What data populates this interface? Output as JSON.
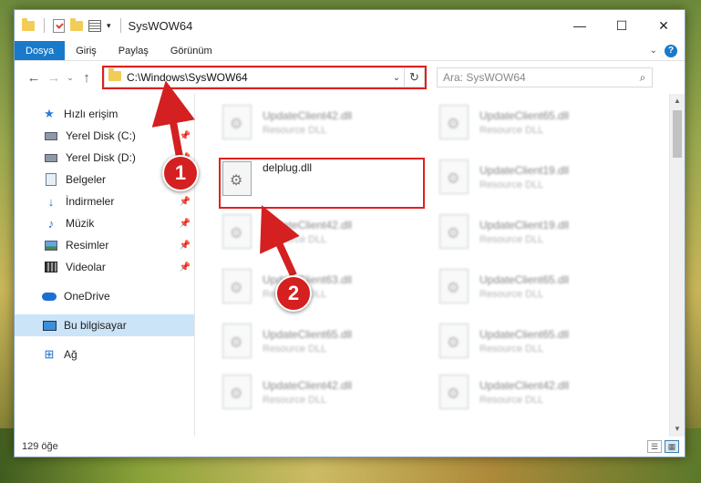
{
  "window": {
    "title": "SysWOW64",
    "controls": {
      "minimize": "—",
      "maximize": "☐",
      "close": "✕"
    }
  },
  "ribbon": {
    "tabs": [
      {
        "label": "Dosya",
        "active": true
      },
      {
        "label": "Giriş",
        "active": false
      },
      {
        "label": "Paylaş",
        "active": false
      },
      {
        "label": "Görünüm",
        "active": false
      }
    ],
    "help_label": "?"
  },
  "navigation": {
    "back": "←",
    "forward": "→",
    "recent": "⌄",
    "up": "↑",
    "address": "C:\\Windows\\SysWOW64",
    "search_placeholder": "Ara: SysWOW64"
  },
  "sidebar": {
    "items": [
      {
        "label": "Hızlı erişim",
        "icon": "star-icon",
        "pinned": false,
        "selected": false
      },
      {
        "label": "Yerel Disk (C:)",
        "icon": "drive-icon",
        "pinned": true,
        "selected": false
      },
      {
        "label": "Yerel Disk (D:)",
        "icon": "drive-icon",
        "pinned": true,
        "selected": false
      },
      {
        "label": "Belgeler",
        "icon": "documents-icon",
        "pinned": true,
        "selected": false
      },
      {
        "label": "İndirmeler",
        "icon": "download-icon",
        "pinned": true,
        "selected": false
      },
      {
        "label": "Müzik",
        "icon": "music-icon",
        "pinned": true,
        "selected": false
      },
      {
        "label": "Resimler",
        "icon": "pictures-icon",
        "pinned": true,
        "selected": false
      },
      {
        "label": "Videolar",
        "icon": "videos-icon",
        "pinned": true,
        "selected": false
      },
      {
        "label": "OneDrive",
        "icon": "cloud-icon",
        "pinned": false,
        "selected": false
      },
      {
        "label": "Bu bilgisayar",
        "icon": "computer-icon",
        "pinned": false,
        "selected": true
      },
      {
        "label": "Ağ",
        "icon": "network-icon",
        "pinned": false,
        "selected": false
      }
    ]
  },
  "files": {
    "left_column": [
      {
        "name": "UpdateClient42.dll",
        "type": "Resource DLL",
        "highlighted": false
      },
      {
        "name": "delplug.dll",
        "type": "",
        "highlighted": true
      },
      {
        "name": "UpdateClient42.dll",
        "type": "Resource DLL",
        "highlighted": false
      },
      {
        "name": "UpdateClient63.dll",
        "type": "Resource DLL",
        "highlighted": false
      },
      {
        "name": "UpdateClient65.dll",
        "type": "Resource DLL",
        "highlighted": false
      },
      {
        "name": "UpdateClient42.dll",
        "type": "Resource DLL",
        "highlighted": false
      }
    ],
    "right_column": [
      {
        "name": "UpdateClient65.dll",
        "type": "Resource DLL"
      },
      {
        "name": "UpdateClient19.dll",
        "type": "Resource DLL"
      },
      {
        "name": "UpdateClient19.dll",
        "type": "Resource DLL"
      },
      {
        "name": "UpdateClient65.dll",
        "type": "Resource DLL"
      },
      {
        "name": "UpdateClient65.dll",
        "type": "Resource DLL"
      },
      {
        "name": "UpdateClient42.dll",
        "type": "Resource DLL"
      }
    ]
  },
  "status": {
    "item_count": "129 öğe"
  },
  "callouts": [
    {
      "number": "1"
    },
    {
      "number": "2"
    }
  ],
  "colors": {
    "accent": "#1979ca",
    "highlight_red": "#e02020",
    "selection": "#cce4f7"
  }
}
